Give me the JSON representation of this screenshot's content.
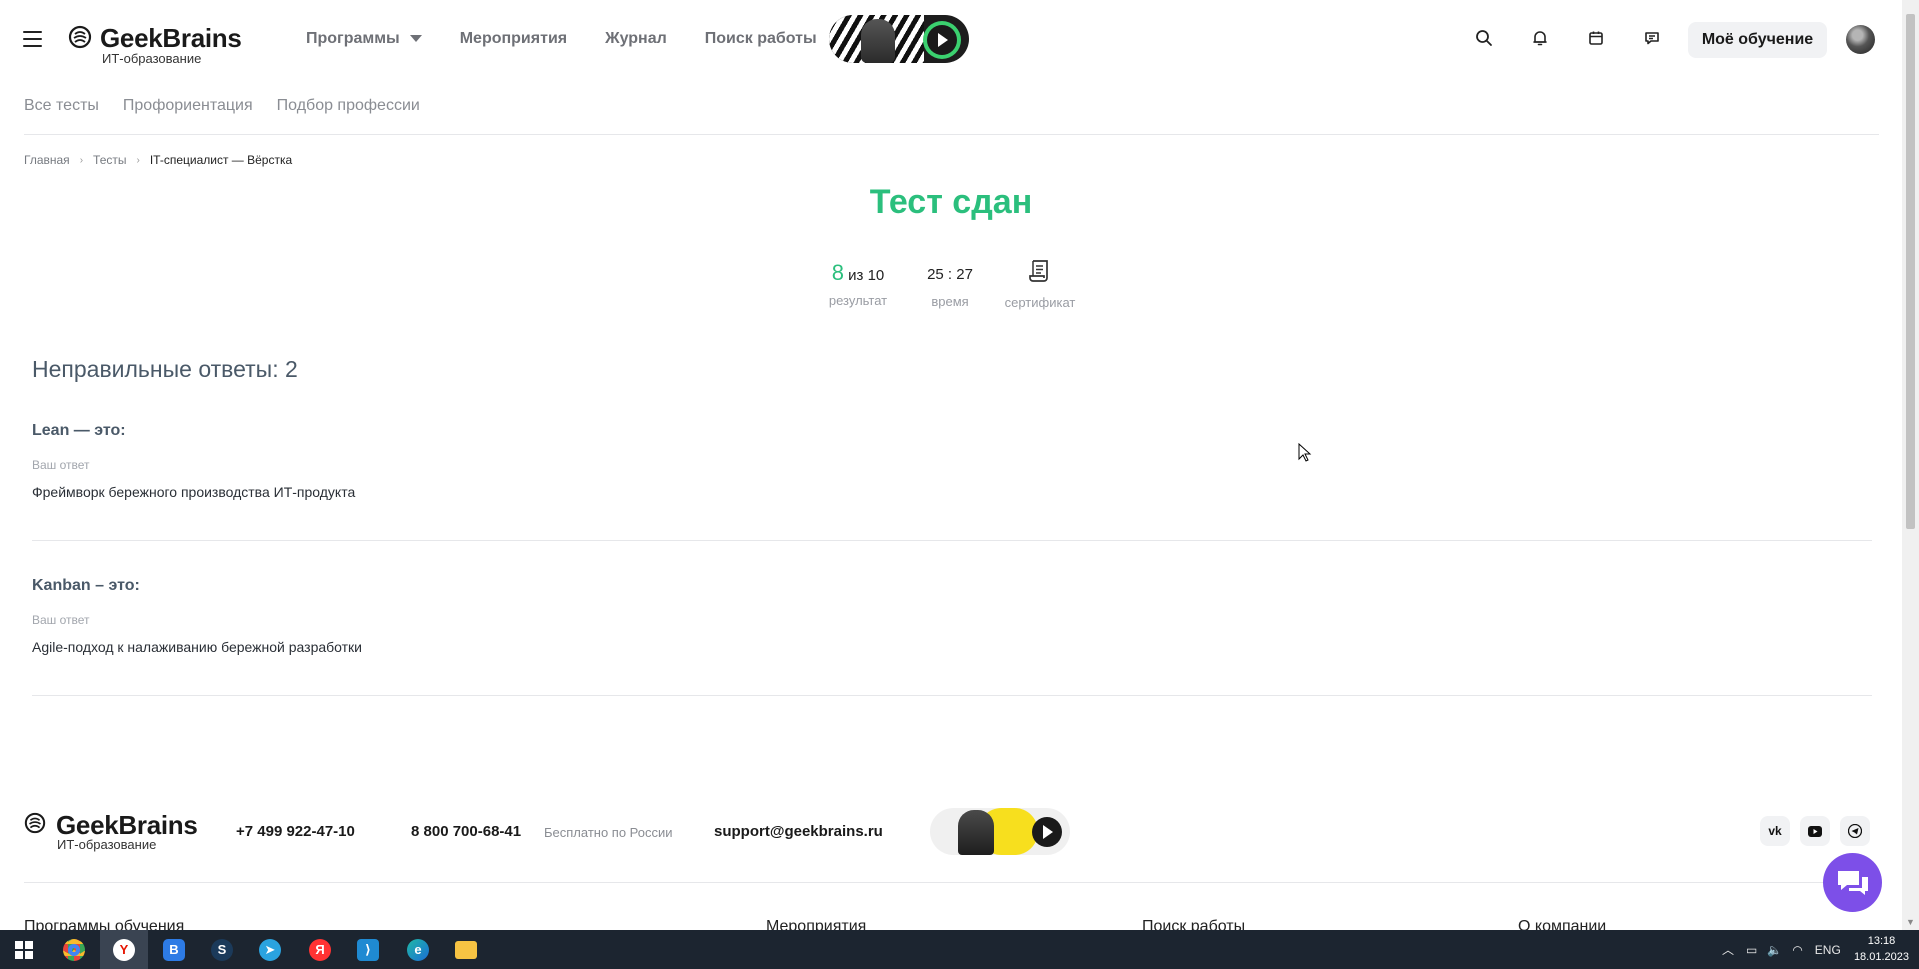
{
  "header": {
    "logo_name": "GeekBrains",
    "logo_sub": "ИТ-образование",
    "nav": [
      "Программы",
      "Мероприятия",
      "Журнал",
      "Поиск работы"
    ],
    "my_learning": "Моё обучение"
  },
  "subnav": [
    "Все тесты",
    "Профориентация",
    "Подбор профессии"
  ],
  "breadcrumb": [
    "Главная",
    "Тесты",
    "IT-специалист — Вёрстка"
  ],
  "result": {
    "title": "Тест сдан",
    "score": "8",
    "score_of": "из 10",
    "score_label": "результат",
    "time": "25 : 27",
    "time_label": "время",
    "certificate_label": "сертификат"
  },
  "wrong": {
    "heading": "Неправильные ответы: 2",
    "items": [
      {
        "question": "Lean — это:",
        "your_answer_label": "Ваш ответ",
        "answer": "Фреймворк бережного производства ИТ-продукта"
      },
      {
        "question": "Kanban – это:",
        "your_answer_label": "Ваш ответ",
        "answer": "Agile-подход к налаживанию бережной разработки"
      }
    ]
  },
  "footer": {
    "logo_name": "GeekBrains",
    "logo_sub": "ИТ-образование",
    "phone1": "+7 499 922-47-10",
    "phone2": "8 800 700-68-41",
    "phone2_note": "Бесплатно по России",
    "email": "support@geekbrains.ru",
    "social": [
      "vk-icon",
      "youtube-icon",
      "telegram-icon"
    ],
    "columns": [
      "Программы обучения",
      "Мероприятия",
      "Поиск работы",
      "О компании"
    ]
  },
  "taskbar": {
    "apps": [
      "start-icon",
      "chrome-icon",
      "yandex-browser-icon",
      "app-icon",
      "steam-icon",
      "telegram-icon",
      "yandex-icon",
      "vscode-icon",
      "edge-icon",
      "explorer-icon"
    ],
    "lang": "ENG",
    "time": "13:18",
    "date": "18.01.2023"
  },
  "colors": {
    "accent": "#2bbf7d",
    "chat": "#7d4fe8"
  }
}
